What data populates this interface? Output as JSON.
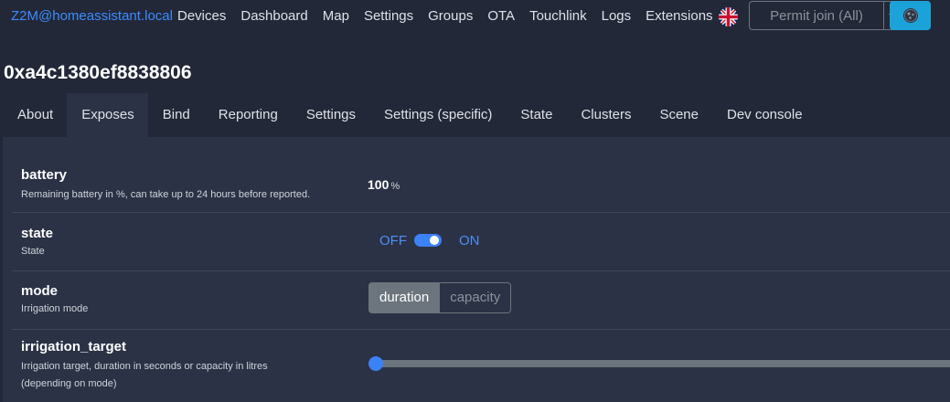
{
  "navbar": {
    "brand": "Z2M@homeassistant.local",
    "links": [
      "Devices",
      "Dashboard",
      "Map",
      "Settings",
      "Groups",
      "OTA",
      "Touchlink",
      "Logs",
      "Extensions"
    ],
    "language_flag": "uk-flag-icon",
    "permit_join_label": "Permit join (All)",
    "theme_icon": "theme-toggle-icon"
  },
  "device": {
    "title": "0xa4c1380ef8838806"
  },
  "tabs": [
    "About",
    "Exposes",
    "Bind",
    "Reporting",
    "Settings",
    "Settings (specific)",
    "State",
    "Clusters",
    "Scene",
    "Dev console"
  ],
  "active_tab": "Exposes",
  "exposes": {
    "battery": {
      "name": "battery",
      "description": "Remaining battery in %, can take up to 24 hours before reported.",
      "value": "100",
      "unit": "%"
    },
    "state": {
      "name": "state",
      "description": "State",
      "off_label": "OFF",
      "on_label": "ON",
      "value": "ON"
    },
    "mode": {
      "name": "mode",
      "description": "Irrigation mode",
      "options": [
        "duration",
        "capacity"
      ],
      "selected": "duration"
    },
    "irrigation_target": {
      "name": "irrigation_target",
      "description_line1": "Irrigation target, duration in seconds or capacity in litres",
      "description_line2": "(depending on mode)",
      "slider_fraction": 0
    }
  },
  "colors": {
    "background": "#222838",
    "card": "#2b3245",
    "brand_link": "#3d8bfd",
    "accent_blue": "#3b82f6",
    "theme_button": "#1ba3d9"
  }
}
